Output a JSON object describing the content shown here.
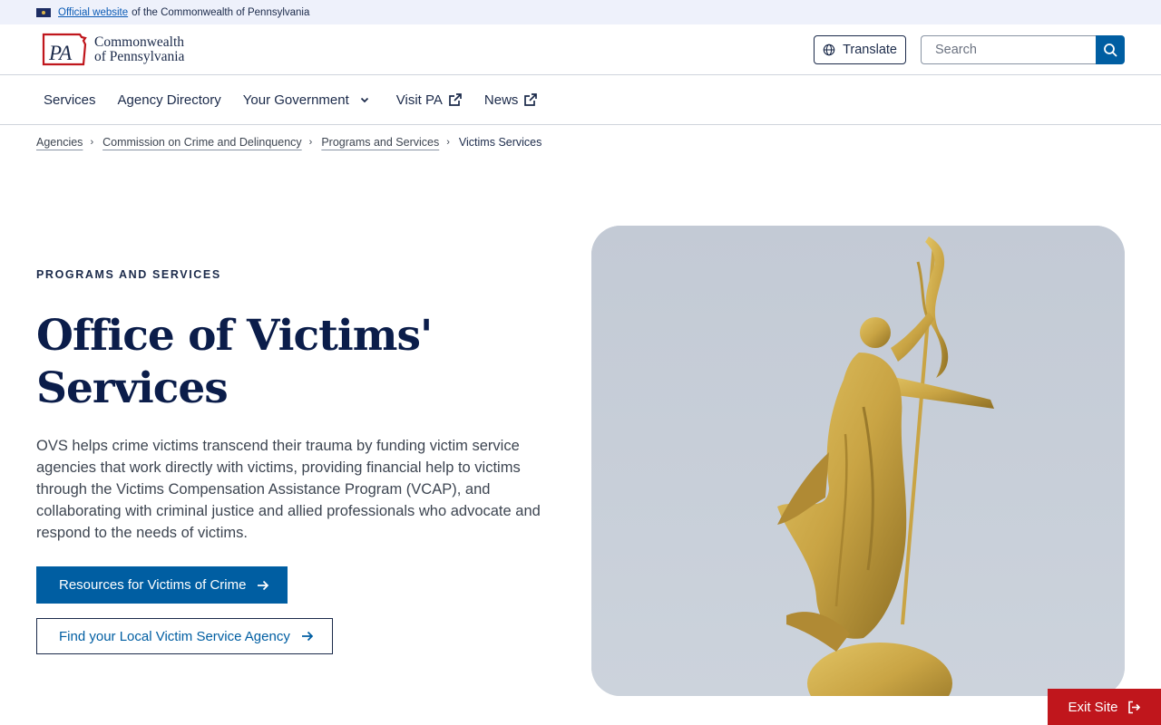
{
  "gov_banner": {
    "link_text": "Official website",
    "rest_text": "of the Commonwealth of Pennsylvania"
  },
  "header": {
    "logo_mark": "PA",
    "logo_line1": "Commonwealth",
    "logo_line2": "of Pennsylvania",
    "translate_label": "Translate",
    "search_placeholder": "Search"
  },
  "nav": {
    "items": [
      {
        "label": "Services"
      },
      {
        "label": "Agency Directory"
      },
      {
        "label": "Your Government"
      },
      {
        "label": "Visit PA"
      },
      {
        "label": "News"
      }
    ]
  },
  "breadcrumb": {
    "items": [
      "Agencies",
      "Commission on Crime and Delinquency",
      "Programs and Services"
    ],
    "current": "Victims Services"
  },
  "hero": {
    "eyebrow": "PROGRAMS AND SERVICES",
    "title": "Office of Victims' Services",
    "description": "OVS helps crime victims transcend their trauma by funding victim service agencies that work directly with victims, providing financial help to victims through the Victims Compensation Assistance Program (VCAP), and collaborating with criminal justice and allied professionals who advocate and respond to the needs of victims.",
    "primary_button": "Resources for Victims of Crime",
    "secondary_button": "Find your Local Victim Service Agency"
  },
  "exit_button": "Exit Site",
  "colors": {
    "primary": "#005ea2",
    "navy": "#0b1d4a",
    "exit": "#c0161c",
    "banner_bg": "#eef1fb"
  }
}
